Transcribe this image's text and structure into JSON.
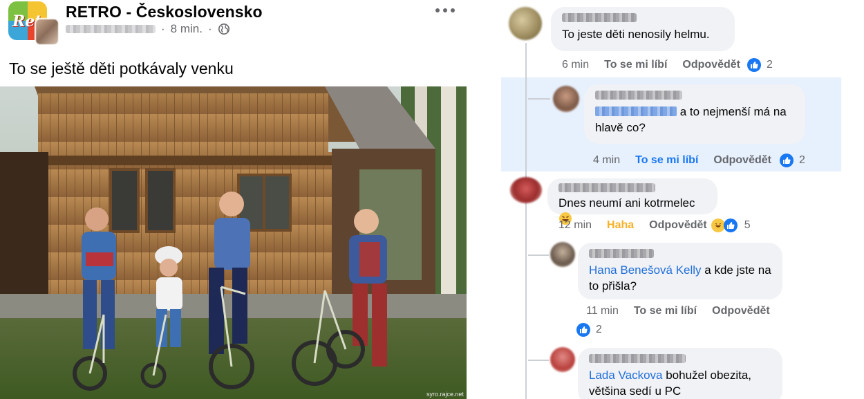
{
  "post": {
    "page_name": "RETRO - Československo",
    "logo_text": "Ret",
    "time": "8 min.",
    "separator": "·",
    "text": "To se ještě děti potkávaly venku",
    "photo_watermark": "syro.rajce.net",
    "icons": [
      "more-icon",
      "globe-icon"
    ]
  },
  "comments": [
    {
      "text": "To jeste děti nenosily helmu.",
      "time": "6 min",
      "like_label": "To se mi líbí",
      "reply_label": "Odpovědět",
      "reaction_count": "2",
      "reactions": [
        "like"
      ]
    },
    {
      "text": "a to nejmenší má na hlavě co?",
      "time": "4 min",
      "like_label": "To se mi líbí",
      "reply_label": "Odpovědět",
      "reaction_count": "2",
      "reactions": [
        "like"
      ],
      "liked": true
    },
    {
      "text": "Dnes neumí ani kotrmelec",
      "time": "12 min",
      "like_label": "Haha",
      "reply_label": "Odpovědět",
      "reaction_count": "5",
      "reactions": [
        "haha",
        "like"
      ]
    },
    {
      "mention": "Hana Benešová Kelly",
      "text": "a kde jste na to přišla?",
      "time": "11 min",
      "like_label": "To se mi líbí",
      "reply_label": "Odpovědět",
      "reaction_count": "2",
      "reactions": [
        "like"
      ]
    },
    {
      "mention": "Lada Vackova",
      "text": "bohužel obezita, většina sedí u PC"
    }
  ],
  "colors": {
    "link": "#216fdb",
    "like_blue": "#1877f2",
    "haha_orange": "#f7b125",
    "bubble": "#f0f2f5",
    "highlight": "#e7f0fd"
  }
}
